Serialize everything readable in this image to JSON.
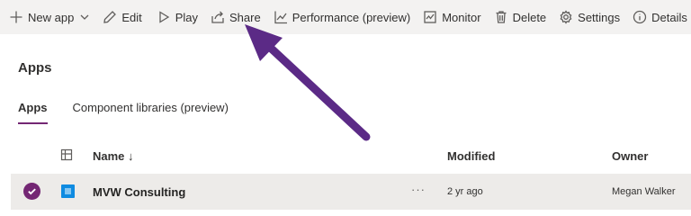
{
  "toolbar": {
    "new_app": "New app",
    "edit": "Edit",
    "play": "Play",
    "share": "Share",
    "performance": "Performance (preview)",
    "monitor": "Monitor",
    "delete": "Delete",
    "settings": "Settings",
    "details": "Details"
  },
  "page": {
    "title": "Apps"
  },
  "tabs": [
    {
      "label": "Apps",
      "active": true
    },
    {
      "label": "Component libraries (preview)",
      "active": false
    }
  ],
  "table": {
    "columns": {
      "name": "Name ↓",
      "modified": "Modified",
      "owner": "Owner"
    },
    "rows": [
      {
        "name": "MVW Consulting",
        "more": "···",
        "modified": "2 yr ago",
        "owner": "Megan Walker",
        "selected": true
      }
    ]
  },
  "colors": {
    "accent": "#742774",
    "command_bar": "#f3f2f1",
    "row_selected": "#edebe9",
    "app_icon": "#0f8be1",
    "annotation_arrow": "#5b2a86"
  }
}
